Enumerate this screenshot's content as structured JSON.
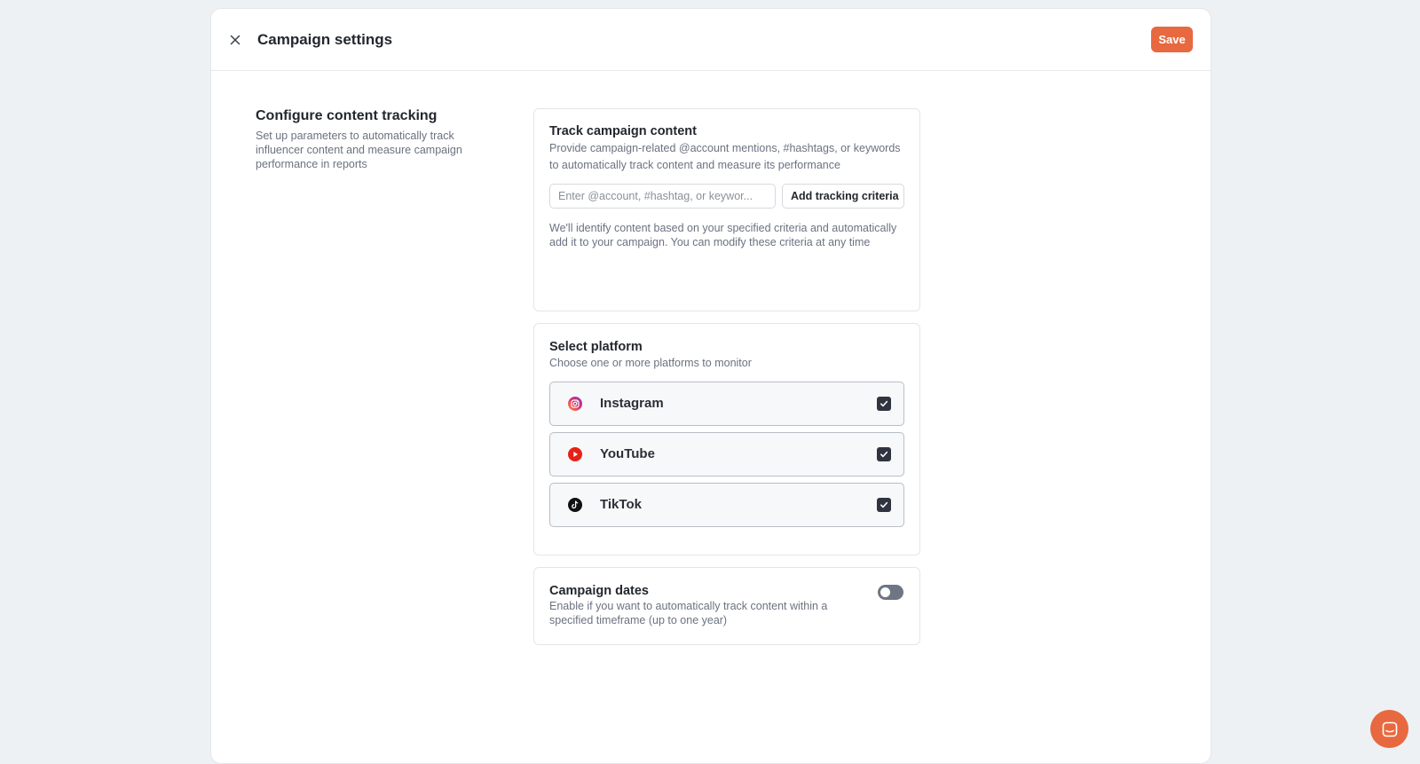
{
  "header": {
    "title": "Campaign settings",
    "save_label": "Save"
  },
  "intro": {
    "title": "Configure content tracking",
    "description": "Set up parameters to automatically track influencer content and measure campaign performance in reports"
  },
  "track": {
    "title": "Track campaign content",
    "description": "Provide campaign-related @account mentions, #hashtags, or keywords to automatically track content and measure its performance",
    "input_placeholder": "Enter @account, #hashtag, or keywor...",
    "input_value": "",
    "add_button_label": "Add tracking criteria",
    "note": "We'll identify content based on your specified criteria and automatically add it to your campaign. You can modify these criteria at any time"
  },
  "platforms": {
    "title": "Select platform",
    "description": "Choose one or more platforms to monitor",
    "items": [
      {
        "label": "Instagram",
        "icon": "instagram-icon",
        "checked": true
      },
      {
        "label": "YouTube",
        "icon": "youtube-icon",
        "checked": true
      },
      {
        "label": "TikTok",
        "icon": "tiktok-icon",
        "checked": true
      }
    ]
  },
  "dates": {
    "title": "Campaign dates",
    "description": "Enable if you want to automatically track content within a specified timeframe (up to one year)",
    "enabled": false
  },
  "colors": {
    "accent": "#e8693f",
    "checkbox": "#2f3440",
    "toggle_off": "#6e7684"
  }
}
